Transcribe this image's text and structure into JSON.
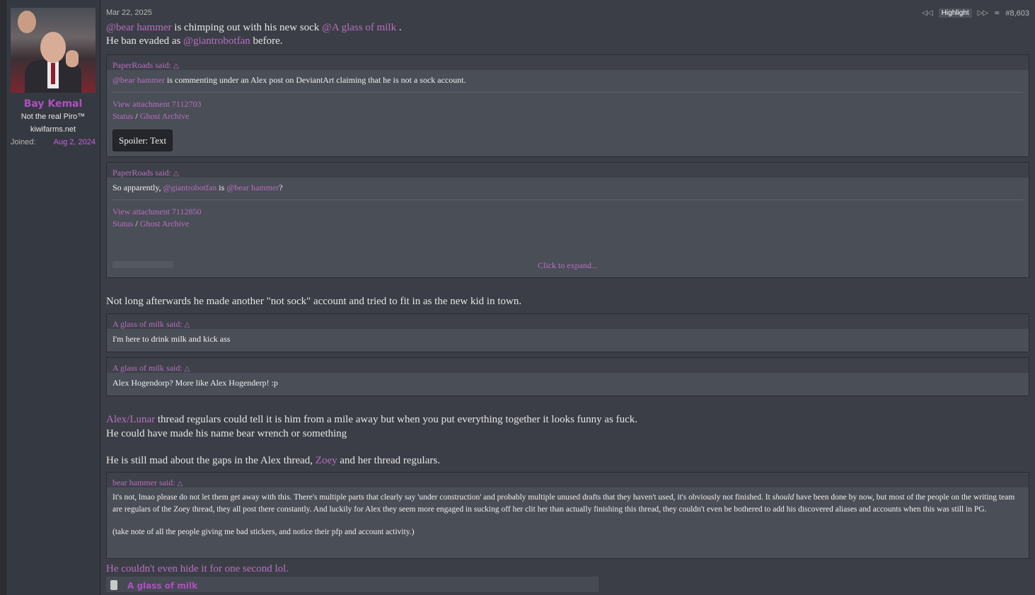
{
  "user": {
    "name": "Bay Kemal",
    "title_line1": "Not the real Piro™",
    "title_line2": "kiwifarms.net",
    "joined_label": "Joined:",
    "joined_value": "Aug 2, 2024"
  },
  "header": {
    "date": "Mar 22, 2025",
    "highlight_label": "Highlight",
    "post_number": "#8,603",
    "icons": [
      "prev-highlight-icon",
      "next-highlight-icon",
      "share-icon"
    ]
  },
  "body": {
    "p1_mention1": "@bear hammer",
    "p1_text1": " is chimping out with his new sock ",
    "p1_mention2": "@A glass of milk",
    "p1_text2": " .",
    "p2_text1": "He ban evaded as ",
    "p2_mention": "@giantrobotfan",
    "p2_text2": " before.",
    "quote1": {
      "author": "PaperRoads said:",
      "mention": "@bear hammer",
      "text": " is commenting under an Alex post on DeviantArt claiming that he is not a sock account.",
      "attachment": "View attachment 7112703",
      "status": "Status",
      "sep": " / ",
      "archive": "Ghost Archive",
      "spoiler": "Spoiler: Text"
    },
    "quote2": {
      "author": "PaperRoads said:",
      "text1": "So apparently, ",
      "mention1": "@giantrobotfan",
      "text2": " is ",
      "mention2": "@bear hammer",
      "text3": "?",
      "attachment": "View attachment 7112850",
      "status": "Status",
      "sep": " / ",
      "archive": "Ghost Archive",
      "expand": "Click to expand..."
    },
    "p3": "Not long afterwards he made another \"not sock\" account and tried to fit in as the new kid in town.",
    "quote3": {
      "author": "A glass of milk said:",
      "text": "I'm here to drink milk and kick ass"
    },
    "quote4": {
      "author": "A glass of milk said:",
      "text": "Alex Hogendorp? More like Alex Hogenderp! :p"
    },
    "p4_link": "Alex/Lunar",
    "p4_text": " thread regulars could tell it is him from a mile away but when you put everything together it looks funny as fuck.",
    "p5": "He could have made his name bear wrench or something",
    "p6_text1": "He is still mad about the gaps in the Alex thread, ",
    "p6_link": "Zoey",
    "p6_text2": " and her thread regulars.",
    "quote5": {
      "author": "bear hammer said:",
      "text1": "It's not, lmao please do not let them get away with this. There's multiple parts that clearly say 'under construction' and probably multiple unused drafts that they haven't used, it's obviously not finished. It ",
      "em": "should",
      "text2": " have been done by now, but most of the people on the writing team are regulars of the Zoey thread, they all post there constantly. And luckily for Alex they seem more engaged in sucking off her clit her than actually finishing this thread, they couldn't even be bothered to add his discovered aliases and accounts when this was still in PG.",
      "text3": "(take note of all the people giving me bad stickers, and notice their pfp and account activity.)"
    },
    "p7_link": "He couldn't even hide it for one second lol.",
    "embed_name": "A glass of milk"
  }
}
